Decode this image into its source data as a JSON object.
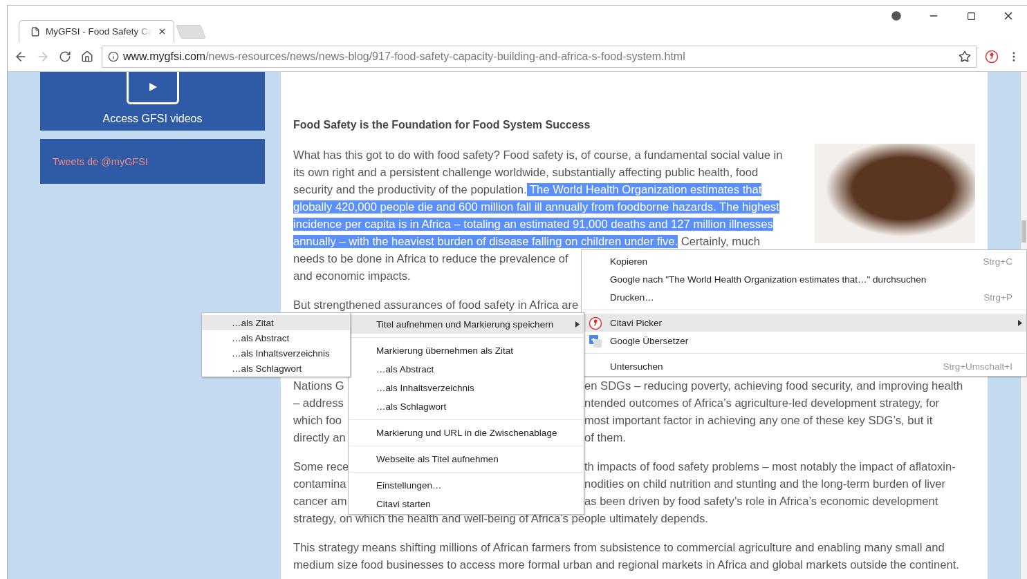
{
  "tabs": [
    {
      "title": "MyGFSI - Food Safety Ca",
      "selected": true
    }
  ],
  "toolbar": {
    "forward_enabled": false,
    "address": {
      "host": "www.mygfsi.com",
      "path": "/news-resources/news/news-blog/917-food-safety-capacity-building-and-africa-s-food-system.html"
    }
  },
  "sidebar": {
    "video_label": "Access GFSI videos",
    "tweets_label": "Tweets de @myGFSI"
  },
  "article": {
    "heading": "Food Safety is the Foundation for Food System Success",
    "paragraphs": [
      {
        "lines": [
          {
            "segments": [
              {
                "text": "What has this got to do with food safety? Food safety is, of course, a fundamental social value in",
                "selected": false
              }
            ]
          },
          {
            "segments": [
              {
                "text": "its own right and a persistent challenge worldwide, substantially affecting public health, food",
                "selected": false
              }
            ]
          },
          {
            "segments": [
              {
                "text": "security and the productivity of the population.",
                "selected": false
              },
              {
                "text": " The World Health Organization estimates that",
                "selected": true
              }
            ]
          },
          {
            "segments": [
              {
                "text": "globally 420,000 people die and 600 million fall ill annually from foodborne hazards. The highest",
                "selected": true
              }
            ]
          },
          {
            "segments": [
              {
                "text": "incidence per capita is in Africa – totaling an estimated 91,000 deaths and 127 million illnesses",
                "selected": true
              }
            ]
          },
          {
            "segments": [
              {
                "text": "annually – with the heaviest burden of disease falling on children under five.",
                "selected": true
              },
              {
                "text": " Certainly, much",
                "selected": false
              }
            ]
          },
          {
            "segments": [
              {
                "text": "needs to be done in Africa to reduce the prevalence of",
                "selected": false
              }
            ]
          },
          {
            "segments": [
              {
                "text": "and economic impacts.",
                "selected": false
              }
            ]
          }
        ]
      },
      {
        "lines": [
          {
            "segments": [
              {
                "text": "But strengthened assurances of food safety in Africa are",
                "selected": false
              }
            ]
          }
        ]
      },
      {
        "lines": [
          {
            "segments": [
              {
                "text": "Nations G",
                "selected": false
              }
            ],
            "right": "en SDGs – reducing poverty, achieving food security, and improving health"
          },
          {
            "segments": [
              {
                "text": "– address",
                "selected": false
              }
            ],
            "right": "ntended outcomes of Africa’s agriculture-led development strategy, for"
          },
          {
            "segments": [
              {
                "text": "which foo",
                "selected": false
              }
            ],
            "right": "most important factor in achieving any one of these key SDG’s, but it"
          },
          {
            "segments": [
              {
                "text": "directly an",
                "selected": false
              }
            ],
            "right": "of them."
          }
        ]
      },
      {
        "lines": [
          {
            "segments": [
              {
                "text": "Some rece",
                "selected": false
              }
            ],
            "right": "th impacts of food safety problems – most notably the impact of aflatoxin-"
          },
          {
            "segments": [
              {
                "text": "contamina",
                "selected": false
              }
            ],
            "right": "nodities on child nutrition and stunting and the long-term burden of liver"
          },
          {
            "segments": [
              {
                "text": "cancer am",
                "selected": false
              }
            ],
            "right": "as been driven by food safety’s role in Africa’s economic development"
          },
          {
            "segments": [
              {
                "text": "strategy, on which the health and well-being of Africa’s people ultimately depends.",
                "selected": false
              }
            ]
          }
        ]
      },
      {
        "lines": [
          {
            "segments": [
              {
                "text": "This strategy means shifting millions of African farmers from subsistence to commercial agriculture and enabling many small and",
                "selected": false
              }
            ]
          },
          {
            "segments": [
              {
                "text": "medium size food businesses to access more formal urban and regional markets in Africa and global markets outside the continent.",
                "selected": false
              }
            ]
          }
        ]
      }
    ]
  },
  "context_menu": {
    "items": [
      {
        "kind": "item",
        "label": "Kopieren",
        "shortcut": "Strg+C",
        "selected": false
      },
      {
        "kind": "item",
        "label": "Google nach \"The World Health Organization estimates that…\" durchsuchen",
        "selected": false
      },
      {
        "kind": "item",
        "label": "Drucken…",
        "shortcut": "Strg+P",
        "selected": false
      },
      {
        "kind": "separator"
      },
      {
        "kind": "citavi",
        "label": "Citavi Picker",
        "submenu": true,
        "selected": true
      },
      {
        "kind": "translate",
        "label": "Google Übersetzer",
        "selected": false
      },
      {
        "kind": "separator"
      },
      {
        "kind": "item",
        "label": "Untersuchen",
        "shortcut": "Strg+Umschalt+I",
        "selected": false
      }
    ]
  },
  "citavi_menu": {
    "items": [
      {
        "kind": "item",
        "label": "Titel aufnehmen und Markierung speichern",
        "submenu": true,
        "selected": true
      },
      {
        "kind": "separator"
      },
      {
        "kind": "item",
        "label": "Markierung übernehmen als Zitat",
        "selected": false
      },
      {
        "kind": "item",
        "label": "…als Abstract",
        "selected": false
      },
      {
        "kind": "item",
        "label": "…als Inhaltsverzeichnis",
        "selected": false
      },
      {
        "kind": "item",
        "label": "…als Schlagwort",
        "selected": false
      },
      {
        "kind": "separator"
      },
      {
        "kind": "item",
        "label": "Markierung und URL in die Zwischenablage",
        "selected": false
      },
      {
        "kind": "separator"
      },
      {
        "kind": "item",
        "label": "Webseite als Titel aufnehmen",
        "selected": false
      },
      {
        "kind": "separator"
      },
      {
        "kind": "item",
        "label": "Einstellungen…",
        "selected": false
      },
      {
        "kind": "item",
        "label": "Citavi starten",
        "selected": false
      }
    ]
  },
  "title_menu": {
    "items": [
      {
        "kind": "item",
        "label": "…als Zitat",
        "selected": true
      },
      {
        "kind": "item",
        "label": "…als Abstract",
        "selected": false
      },
      {
        "kind": "item",
        "label": "…als Inhaltsverzeichnis",
        "selected": false
      },
      {
        "kind": "item",
        "label": "…als Schlagwort",
        "selected": false
      }
    ]
  }
}
